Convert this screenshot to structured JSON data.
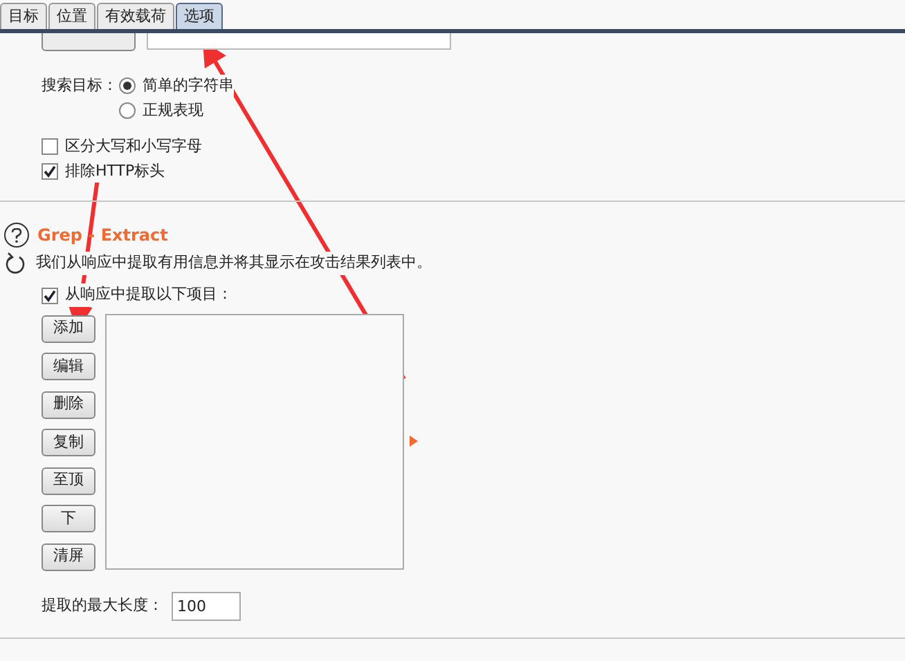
{
  "tabs": [
    {
      "label": "目标",
      "selected": false
    },
    {
      "label": "位置",
      "selected": false
    },
    {
      "label": "有效载荷",
      "selected": false
    },
    {
      "label": "选项",
      "selected": true
    }
  ],
  "search_target": {
    "label": "搜索目标：",
    "options": [
      {
        "label": "简单的字符串",
        "selected": true
      },
      {
        "label": "正规表现",
        "selected": false
      }
    ]
  },
  "flags": [
    {
      "label": "区分大写和小写字母",
      "checked": false
    },
    {
      "label": "排除HTTP标头",
      "checked": true
    }
  ],
  "section": {
    "title": "Grep - Extract",
    "description": "我们从响应中提取有用信息并将其显示在攻击结果列表中。",
    "extract": {
      "label": "从响应中提取以下项目：",
      "checked": true
    },
    "buttons": [
      "添加",
      "编辑",
      "删除",
      "复制",
      "至顶",
      "下",
      "清屏"
    ],
    "max_length": {
      "label": "提取的最大长度：",
      "value": "100"
    }
  }
}
